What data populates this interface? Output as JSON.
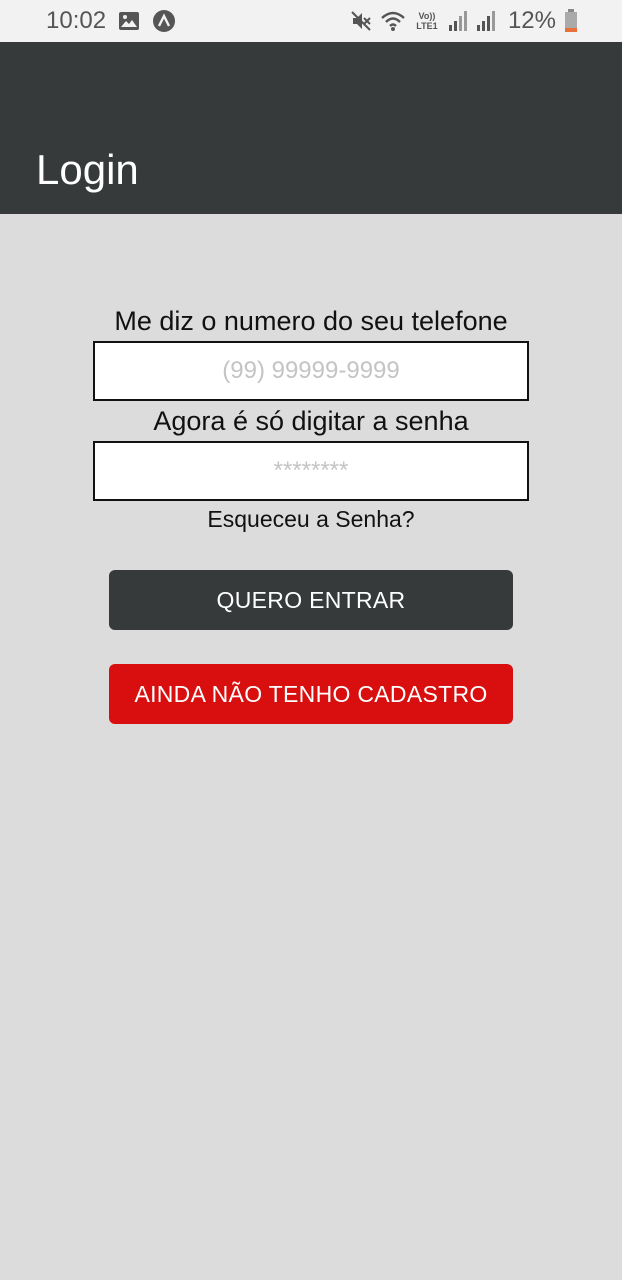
{
  "status_bar": {
    "time": "10:02",
    "battery": "12%",
    "icons": [
      "image-icon",
      "app-notification-icon",
      "mute-icon",
      "wifi-icon",
      "volte-icon",
      "signal-icon",
      "signal-icon",
      "battery-icon"
    ],
    "volte_label": "Vo)) LTE1"
  },
  "app_bar": {
    "title": "Login",
    "color": "#363a3b"
  },
  "form": {
    "phone_label": "Me diz o numero do seu telefone",
    "phone_placeholder": "(99) 99999-9999",
    "password_label": "Agora é só digitar a senha",
    "password_placeholder": "********",
    "forgot_link": "Esqueceu a Senha?",
    "login_button": "QUERO ENTRAR",
    "register_button": "AINDA NÃO TENHO CADASTRO"
  },
  "colors": {
    "background": "#dcdcdc",
    "primary_button": "#363a3b",
    "register_button": "#d90f0f"
  }
}
